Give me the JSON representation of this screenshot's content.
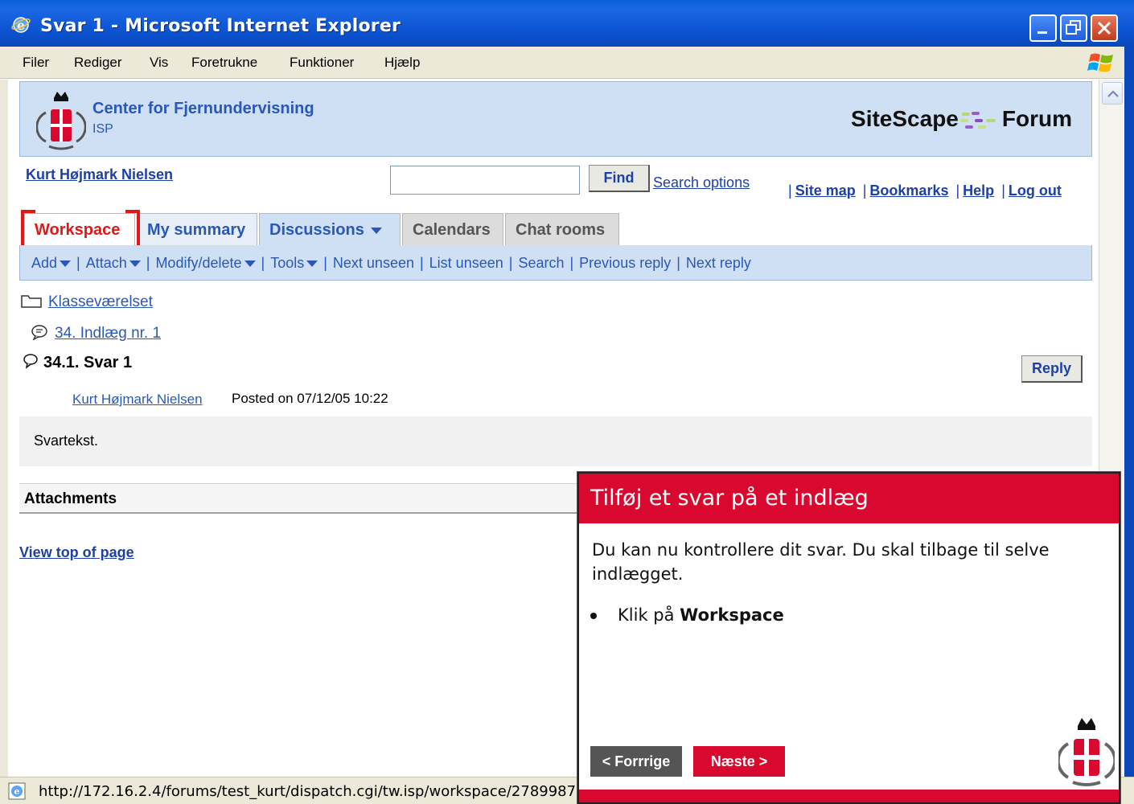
{
  "window": {
    "title": "Svar 1 - Microsoft Internet Explorer"
  },
  "menu": [
    "Filer",
    "Rediger",
    "Vis",
    "Foretrukne",
    "Funktioner",
    "Hjælp"
  ],
  "banner": {
    "org_name": "Center for Fjernundervisning",
    "org_sub": "ISP",
    "product_left": "SiteScape",
    "product_right": "Forum"
  },
  "header": {
    "user": "Kurt Højmark Nielsen",
    "search_value": "",
    "find_label": "Find",
    "search_options": "Search options",
    "links": [
      "Site map",
      "Bookmarks",
      "Help",
      "Log out"
    ]
  },
  "tabs": [
    "Workspace",
    "My summary",
    "Discussions",
    "Calendars",
    "Chat rooms"
  ],
  "actions": [
    "Add",
    "Attach",
    "Modify/delete",
    "Tools",
    "Next unseen",
    "List unseen",
    "Search",
    "Previous reply",
    "Next reply"
  ],
  "content": {
    "folder": "Klasseværelset",
    "parent_entry": "34. Indlæg nr. 1",
    "entry_title": "34.1. Svar 1",
    "reply_label": "Reply",
    "author": "Kurt Højmark Nielsen",
    "posted": "Posted on 07/12/05 10:22",
    "body": "Svartekst.",
    "attachments_label": "Attachments",
    "view_top": "View top of page"
  },
  "status": {
    "url": "http://172.16.2.4/forums/test_kurt/dispatch.cgi/tw.isp/workspace/2789987"
  },
  "tutorial": {
    "title": "Tilføj et svar på et indlæg",
    "text": "Du kan nu kontrollere dit svar. Du skal tilbage til selve indlægget.",
    "bullet_prefix": "Klik på",
    "bullet_bold": "Workspace",
    "prev_label": "< Forrrige",
    "next_label": "Næste >"
  },
  "colors": {
    "accent_red": "#d9082e",
    "link_blue": "#2a58b8",
    "banner_bg": "#cfe0f4"
  }
}
